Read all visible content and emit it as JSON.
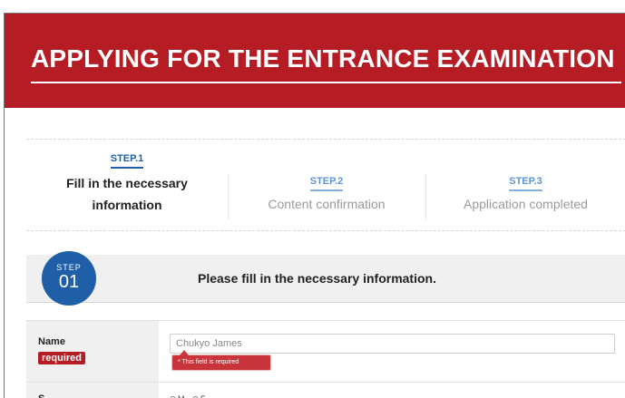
{
  "header": {
    "title": "APPLYING FOR THE ENTRANCE EXAMINATION"
  },
  "steps": [
    {
      "number": "STEP.1",
      "label_line1": "Fill in the necessary",
      "label_line2": "information",
      "active": true
    },
    {
      "number": "STEP.2",
      "label": "Content confirmation",
      "active": false
    },
    {
      "number": "STEP.3",
      "label": "Application completed",
      "active": false
    }
  ],
  "section": {
    "badge_label": "STEP",
    "badge_number": "01",
    "title": "Please fill in the necessary information."
  },
  "form": {
    "name_field": {
      "label": "Name",
      "required_badge": "required",
      "value": "Chukyo James",
      "error": "* This field is required"
    },
    "next_field": {
      "label": "S",
      "options": [
        "M",
        "F"
      ]
    }
  },
  "colors": {
    "brand_red": "#b51c24",
    "step_blue": "#1f5fa8",
    "error_red": "#c9343a"
  }
}
